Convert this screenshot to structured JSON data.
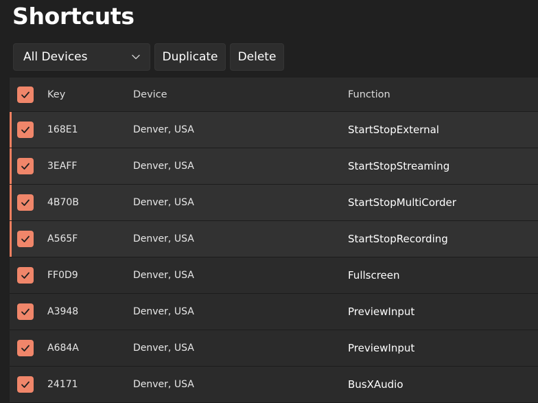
{
  "page": {
    "title": "Shortcuts"
  },
  "toolbar": {
    "device_filter": "All Devices",
    "duplicate_label": "Duplicate",
    "delete_label": "Delete"
  },
  "table": {
    "columns": {
      "key": "Key",
      "device": "Device",
      "function": "Function"
    },
    "rows": [
      {
        "key": "168E1",
        "device": "Denver, USA",
        "function": "StartStopExternal",
        "checked": true,
        "selected": true
      },
      {
        "key": "3EAFF",
        "device": "Denver, USA",
        "function": "StartStopStreaming",
        "checked": true,
        "selected": true
      },
      {
        "key": "4B70B",
        "device": "Denver, USA",
        "function": "StartStopMultiCorder",
        "checked": true,
        "selected": true
      },
      {
        "key": "A565F",
        "device": "Denver, USA",
        "function": "StartStopRecording",
        "checked": true,
        "selected": true
      },
      {
        "key": "FF0D9",
        "device": "Denver, USA",
        "function": "Fullscreen",
        "checked": true,
        "selected": false
      },
      {
        "key": "A3948",
        "device": "Denver, USA",
        "function": "PreviewInput",
        "checked": true,
        "selected": false
      },
      {
        "key": "A684A",
        "device": "Denver, USA",
        "function": "PreviewInput",
        "checked": true,
        "selected": false
      },
      {
        "key": "24171",
        "device": "Denver, USA",
        "function": "BusXAudio",
        "checked": true,
        "selected": false
      }
    ]
  },
  "colors": {
    "accent": "#f0866a",
    "selection_bar": "#f08060",
    "background": "#202020",
    "row": "#2b2b2b",
    "row_selected": "#323232"
  },
  "icons": {
    "checkbox": "checkmark-icon",
    "dropdown": "chevron-down-icon"
  }
}
